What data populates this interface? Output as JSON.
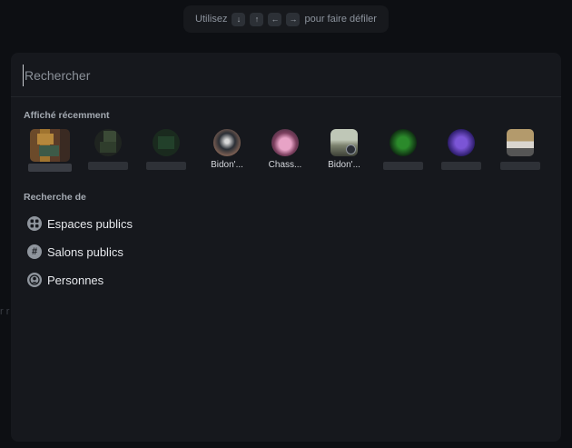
{
  "hint": {
    "prefix": "Utilisez",
    "keys": [
      "↓",
      "↑",
      "←",
      "→"
    ],
    "suffix": "pour faire défiler"
  },
  "background_fragment": "r r",
  "search": {
    "placeholder": "Rechercher",
    "value": ""
  },
  "recent": {
    "title": "Affiché récemment",
    "items": [
      {
        "label": "",
        "icon": "avatar-blurred"
      },
      {
        "label": "",
        "icon": "avatar-blurred"
      },
      {
        "label": "",
        "icon": "avatar-blurred"
      },
      {
        "label": "Bidon'...",
        "icon": "room-avatar"
      },
      {
        "label": "Chass...",
        "icon": "room-avatar"
      },
      {
        "label": "Bidon'...",
        "icon": "room-avatar"
      },
      {
        "label": "",
        "icon": "avatar-blurred"
      },
      {
        "label": "",
        "icon": "avatar-blurred"
      },
      {
        "label": "",
        "icon": "avatar-blurred"
      }
    ]
  },
  "search_for": {
    "title": "Recherche de",
    "options": [
      {
        "label": "Espaces publics",
        "icon": "spaces-icon"
      },
      {
        "label": "Salons publics",
        "icon": "hash-icon"
      },
      {
        "label": "Personnes",
        "icon": "person-icon"
      }
    ]
  },
  "colors": {
    "dialog_bg": "#16181d",
    "page_bg": "#0d0f13",
    "text": "#e6e8ec",
    "muted": "#8b9199"
  }
}
